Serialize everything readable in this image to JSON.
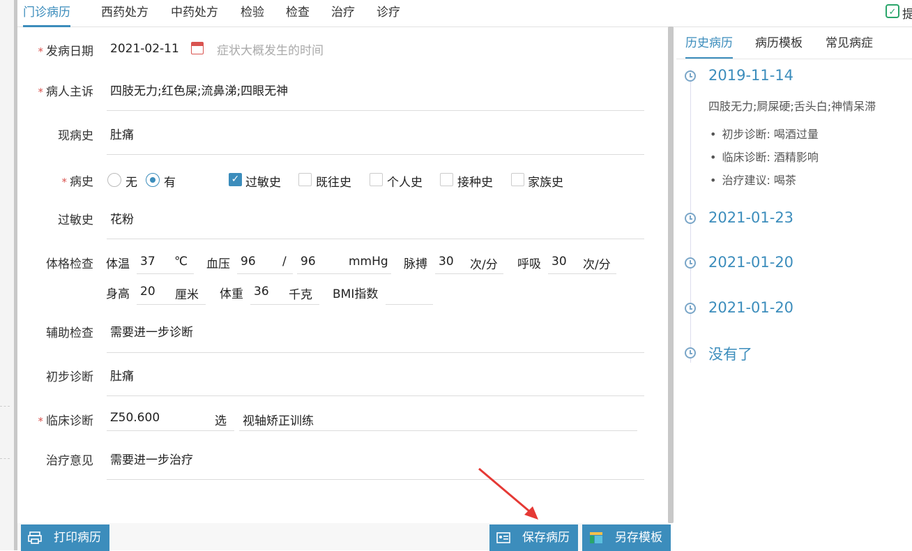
{
  "tabs": [
    "门诊病历",
    "西药处方",
    "中药处方",
    "检验",
    "检查",
    "治疗",
    "诊疗"
  ],
  "corner_label": "提",
  "form": {
    "onset_date": {
      "label": "发病日期",
      "value": "2021-02-11",
      "placeholder": "症状大概发生的时间"
    },
    "complaint": {
      "label": "病人主诉",
      "value": "四肢无力;红色屎;流鼻涕;四眼无神"
    },
    "present_history": {
      "label": "现病史",
      "value": "肚痛"
    },
    "history": {
      "label": "病史",
      "radios": [
        {
          "label": "无",
          "checked": false
        },
        {
          "label": "有",
          "checked": true
        }
      ],
      "checks": [
        {
          "label": "过敏史",
          "checked": true
        },
        {
          "label": "既往史",
          "checked": false
        },
        {
          "label": "个人史",
          "checked": false
        },
        {
          "label": "接种史",
          "checked": false
        },
        {
          "label": "家族史",
          "checked": false
        }
      ]
    },
    "allergy": {
      "label": "过敏史",
      "value": "花粉"
    },
    "physical": {
      "label": "体格检查",
      "temp_label": "体温",
      "temp": "37",
      "temp_unit": "℃",
      "bp_label": "血压",
      "bp_sys": "96",
      "bp_sep": "/",
      "bp_dia": "96",
      "bp_unit": "mmHg",
      "pulse_label": "脉搏",
      "pulse": "30",
      "pulse_unit": "次/分",
      "resp_label": "呼吸",
      "resp": "30",
      "resp_unit": "次/分",
      "height_label": "身高",
      "height": "20",
      "height_unit": "厘米",
      "weight_label": "体重",
      "weight": "36",
      "weight_unit": "千克",
      "bmi_label": "BMI指数",
      "bmi": ""
    },
    "aux_exam": {
      "label": "辅助检查",
      "value": "需要进一步诊断"
    },
    "prelim_diag": {
      "label": "初步诊断",
      "value": "肚痛"
    },
    "clinical_diag": {
      "label": "临床诊断",
      "code": "Z50.600",
      "select": "选",
      "name": "视轴矫正训练"
    },
    "treatment": {
      "label": "治疗意见",
      "value": "需要进一步治疗"
    }
  },
  "buttons": {
    "print": "打印病历",
    "save": "保存病历",
    "save_template": "另存模板"
  },
  "right_panel": {
    "tabs": [
      "历史病历",
      "病历模板",
      "常见病症"
    ],
    "timeline": [
      {
        "date": "2019-11-14",
        "summary": "四肢无力;屙屎硬;舌头白;神情呆滞",
        "details": [
          "初步诊断: 喝酒过量",
          "临床诊断: 酒精影响",
          "治疗建议: 喝茶"
        ]
      },
      {
        "date": "2021-01-23"
      },
      {
        "date": "2021-01-20"
      },
      {
        "date": "2021-01-20"
      },
      {
        "date": "没有了"
      }
    ]
  },
  "colors": {
    "accent": "#3c8dbc",
    "required": "#d9534f",
    "annotation_arrow": "#e53935"
  }
}
